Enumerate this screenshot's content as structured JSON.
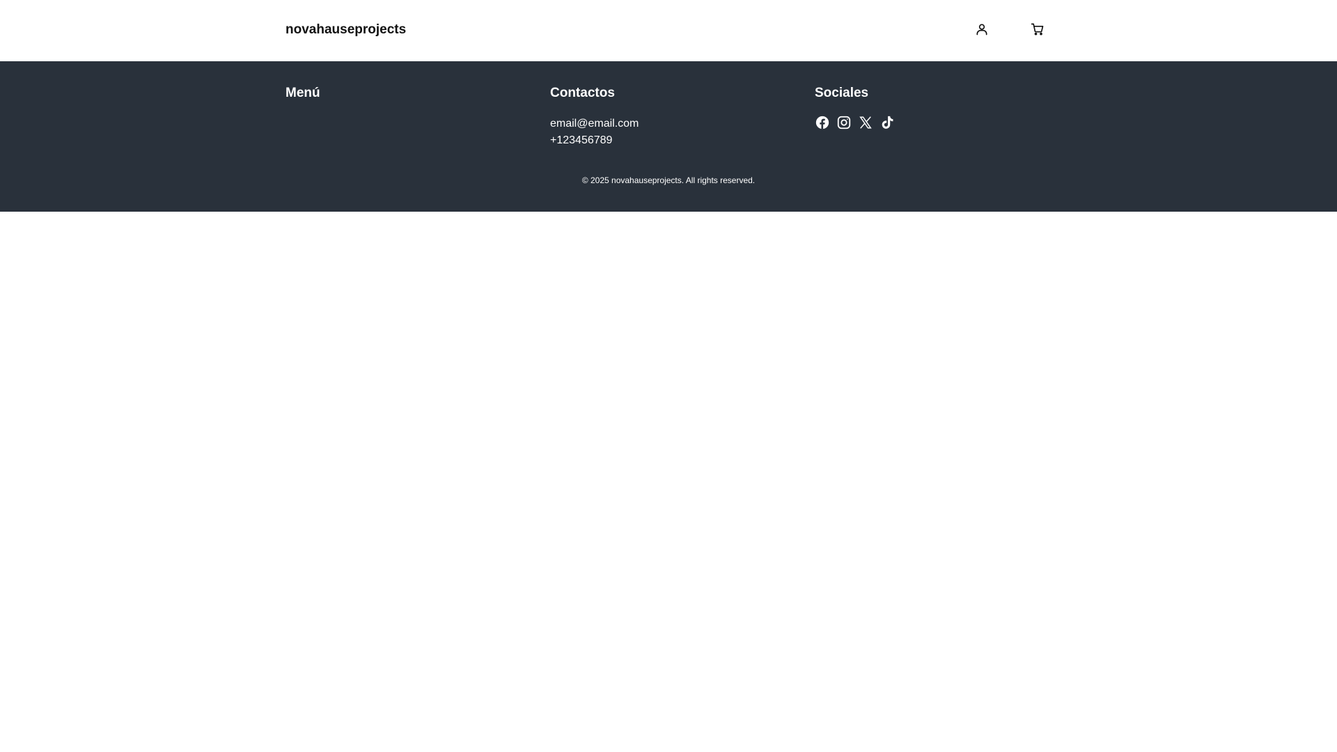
{
  "header": {
    "brand": "novahauseprojects",
    "account_icon": "user-icon",
    "cart_icon": "cart-icon"
  },
  "footer": {
    "menu_title": "Menú",
    "contact_title": "Contactos",
    "contact": {
      "email": "email@email.com",
      "phone": "+123456789"
    },
    "social_title": "Sociales",
    "social_icons": [
      "facebook-icon",
      "instagram-icon",
      "x-icon",
      "tiktok-icon"
    ],
    "copyright": "© 2025 novahauseprojects. All rights reserved."
  },
  "colors": {
    "footer_bg": "#29313b",
    "text_dark": "#111111",
    "text_light": "#ffffff"
  }
}
